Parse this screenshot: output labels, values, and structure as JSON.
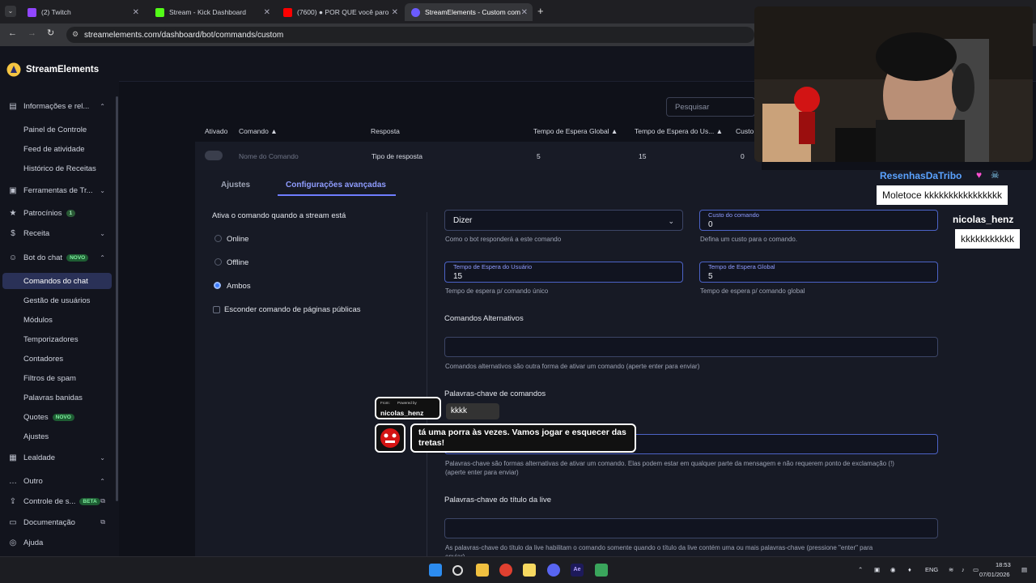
{
  "browser": {
    "tabs": [
      {
        "label": "(2) Twitch",
        "color": "#9146ff"
      },
      {
        "label": "Stream - Kick Dashboard",
        "color": "#53fc18"
      },
      {
        "label": "(7600) ● POR QUE você paro",
        "color": "#ff0000"
      },
      {
        "label": "StreamElements - Custom comm",
        "color": "#6b5bff"
      }
    ],
    "new_tab": "+",
    "url": "streamelements.com/dashboard/bot/commands/custom"
  },
  "sidebar": {
    "brand": "StreamElements",
    "items": [
      {
        "label": "Informações e rel...",
        "icon": "chart-icon",
        "chev": "^"
      },
      {
        "label": "Painel de Controle"
      },
      {
        "label": "Feed de atividade"
      },
      {
        "label": "Histórico de Receitas"
      },
      {
        "label": "Ferramentas de Tr...",
        "icon": "tools-icon",
        "chev": "v"
      },
      {
        "label": "Patrocínios",
        "icon": "star-icon",
        "badge": "1"
      },
      {
        "label": "Receita",
        "icon": "dollar-icon",
        "chev": "v"
      },
      {
        "label": "Bot do chat",
        "icon": "bot-icon",
        "badge": "NOVO",
        "chev": "^"
      },
      {
        "label": "Comandos do chat"
      },
      {
        "label": "Gestão de usuários"
      },
      {
        "label": "Módulos"
      },
      {
        "label": "Temporizadores"
      },
      {
        "label": "Contadores"
      },
      {
        "label": "Filtros de spam"
      },
      {
        "label": "Palavras banidas"
      },
      {
        "label": "Quotes",
        "badge": "NOVO"
      },
      {
        "label": "Ajustes"
      },
      {
        "label": "Lealdade",
        "icon": "loyalty-icon",
        "chev": "v"
      },
      {
        "label": "Outro",
        "icon": "more-icon",
        "chev": "^"
      },
      {
        "label": "Controle de s...",
        "icon": "control-icon",
        "badge": "BETA"
      },
      {
        "label": "Documentação",
        "icon": "doc-icon"
      },
      {
        "label": "Ajuda",
        "icon": "help-icon"
      }
    ]
  },
  "table": {
    "search_placeholder": "Pesquisar",
    "headers": [
      "Ativado",
      "Comando ▲",
      "Resposta",
      "Tempo de Espera Global ▲",
      "Tempo de Espera do Us... ▲",
      "Custo"
    ],
    "row": {
      "command": "Nome do Comando",
      "response": "Tipo de resposta",
      "global_cd": "5",
      "user_cd": "15",
      "cost": "0"
    }
  },
  "editor": {
    "tabs": [
      "Ajustes",
      "Configurações avançadas"
    ],
    "activation_title": "Ativa o comando quando a stream está",
    "options": [
      "Online",
      "Offline",
      "Ambos"
    ],
    "hide_label": "Esconder comando de páginas públicas",
    "response_type": {
      "value": "Dizer",
      "hint": "Como o bot responderá a este comando"
    },
    "cost": {
      "label": "Custo do comando",
      "value": "0",
      "hint": "Defina um custo para o comando."
    },
    "user_cd": {
      "label": "Tempo de Espera do Usuário",
      "value": "15",
      "hint": "Tempo de espera p/ comando único"
    },
    "global_cd": {
      "label": "Tempo de Espera Global",
      "value": "5",
      "hint": "Tempo de espera p/ comando global"
    },
    "aliases": {
      "title": "Comandos Alternativos",
      "hint": "Comandos alternativos são outra forma de ativar um comando (aperte enter para enviar)"
    },
    "keywords": {
      "title": "Palavras-chave de comandos",
      "hint1": "Palavras-chave são formas alternativas de ativar um comando. Elas podem estar em qualquer parte da mensagem e não requerem ponto de exclamação (!)",
      "hint2": "(aperte enter para enviar)"
    },
    "title_keywords": {
      "title": "Palavras-chave do título da live",
      "hint1": "As palavras-chave do título da live habilitam o comando somente quando o título da live contém uma ou mais palavras-chave (pressione \"enter\" para",
      "hint2": "enviar)"
    }
  },
  "overlay": {
    "chat": [
      {
        "user": "ResenhasDaTribo",
        "message": "Moletoce kkkkkkkkkkkkkkkk",
        "color": "#5aa2ff"
      },
      {
        "user": "nicolas_henz",
        "message": "kkkkkkkkkkk",
        "color": "#ffffff"
      }
    ],
    "alert": {
      "from": "From:",
      "powered": "Powered by",
      "user": "nicolas_henz",
      "tts": "kkkk",
      "message": "tá uma porra às vezes. Vamos jogar e esquecer das tretas!"
    }
  },
  "taskbar": {
    "lang": "ENG",
    "time": "18:53",
    "date": "07/01/2026"
  }
}
